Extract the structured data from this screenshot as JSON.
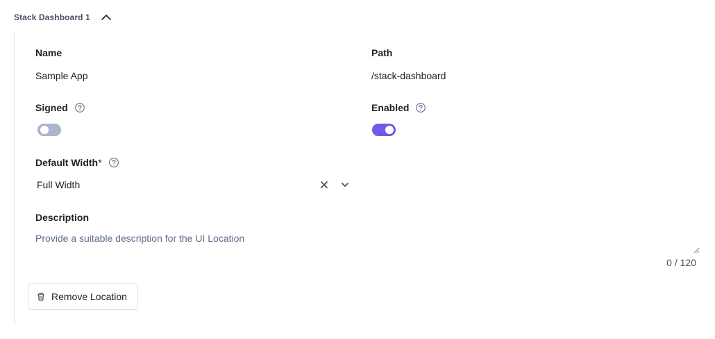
{
  "section": {
    "title": "Stack Dashboard 1",
    "expanded": true
  },
  "fields": {
    "name": {
      "label": "Name",
      "value": "Sample App"
    },
    "path": {
      "label": "Path",
      "value": "/stack-dashboard"
    },
    "signed": {
      "label": "Signed",
      "enabled": false
    },
    "enabled": {
      "label": "Enabled",
      "enabled": true
    },
    "default_width": {
      "label": "Default Width",
      "required_mark": "*",
      "value": "Full Width"
    },
    "description": {
      "label": "Description",
      "placeholder": "Provide a suitable description for the UI Location",
      "counter": "0 / 120"
    }
  },
  "actions": {
    "remove_label": "Remove Location"
  },
  "colors": {
    "accent": "#6c5ce7",
    "toggle_off": "#a9b6cb",
    "muted_text": "#5d6c89",
    "border": "#dde3ee"
  },
  "icons": [
    "chevron-up-icon",
    "help-icon",
    "close-icon",
    "chevron-down-icon",
    "trash-icon"
  ]
}
